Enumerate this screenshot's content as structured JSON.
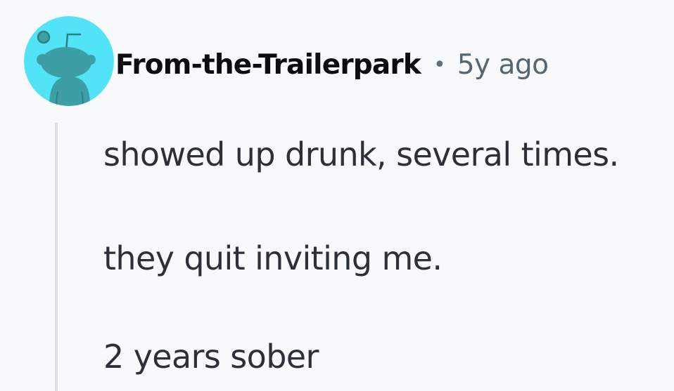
{
  "comment": {
    "author": "From-the-Trailerpark",
    "separator": "•",
    "timestamp": "5y ago",
    "body": [
      "showed up drunk, several times.",
      "they quit inviting me.",
      "2 years sober"
    ]
  },
  "avatar": {
    "icon": "snoo-avatar-icon",
    "background_color": "#52e3f6",
    "figure_color": "#3d9ea6"
  },
  "colors": {
    "page_background": "#f8f9fb",
    "username": "#0b0d10",
    "meta": "#556572",
    "body_text": "#2b3138",
    "thread_line": "#d9e2e8"
  }
}
